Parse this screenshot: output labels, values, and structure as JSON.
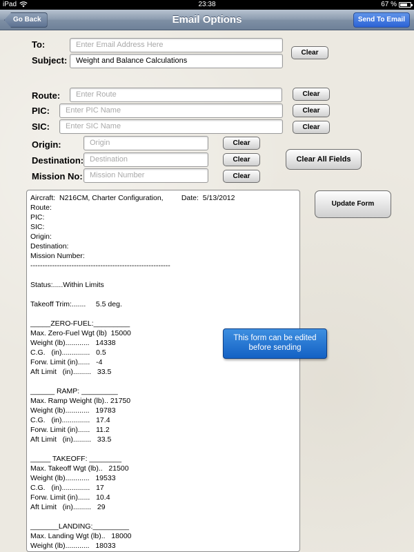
{
  "status_bar": {
    "device": "iPad",
    "time": "23:38",
    "battery": "67 %"
  },
  "nav": {
    "back_label": "Go Back",
    "title": "Email Options",
    "send_label": "Send To Email"
  },
  "form": {
    "to": {
      "label": "To:",
      "placeholder": "Enter Email Address Here",
      "clear": "Clear"
    },
    "subject": {
      "label": "Subject:",
      "value": "Weight and Balance Calculations"
    },
    "route": {
      "label": "Route:",
      "placeholder": "Enter Route",
      "clear": "Clear"
    },
    "pic": {
      "label": "PIC:",
      "placeholder": "Enter PIC Name",
      "clear": "Clear"
    },
    "sic": {
      "label": "SIC:",
      "placeholder": "Enter SIC Name",
      "clear": "Clear"
    },
    "origin": {
      "label": "Origin:",
      "placeholder": "Origin",
      "clear": "Clear"
    },
    "destination": {
      "label": "Destination:",
      "placeholder": "Destination",
      "clear": "Clear"
    },
    "mission": {
      "label": "Mission No:",
      "placeholder": "Mission Number",
      "clear": "Clear"
    },
    "clear_all": "Clear All Fields",
    "update": "Update Form"
  },
  "report_lines": [
    "Aircraft:  N216CM, Charter Configuration,         Date:  5/13/2012",
    "Route:",
    "PIC:",
    "SIC:",
    "Origin:",
    "Destination:",
    "Mission Number:",
    "----------------------------------------------------------",
    "",
    "Status:.....Within Limits",
    "",
    "Takeoff Trim:.......     5.5 deg.",
    "",
    "_____ZERO-FUEL:_________",
    "Max. Zero-Fuel Wgt (lb)  15000",
    "Weight (lb)............   14338",
    "C.G.   (in)..............   0.5",
    "Forw. Limit (in)......   -4",
    "Aft Limit   (in).........   33.5",
    "",
    "______ RAMP: _________",
    "Max. Ramp Weight (lb).. 21750",
    "Weight (lb)............   19783",
    "C.G.   (in)..............   17.4",
    "Forw. Limit (in)......   11.2",
    "Aft Limit   (in).........   33.5",
    "",
    "_____ TAKEOFF: ________",
    "Max. Takeoff Wgt (lb)..   21500",
    "Weight (lb)............   19533",
    "C.G.   (in)..............   17",
    "Forw. Limit (in)......   10.4",
    "Aft Limit   (in).........   29",
    "",
    "_______LANDING:_________",
    "Max. Landing Wgt (lb)..   18000",
    "Weight (lb)............   18033"
  ],
  "tooltip": {
    "line1": "This form can be edited",
    "line2": "before sending"
  },
  "colors": {
    "nav_bar": "#8a9aae",
    "send_button": "#2c63d6",
    "tooltip": "#1f6fd0",
    "background": "#ece9e1"
  }
}
